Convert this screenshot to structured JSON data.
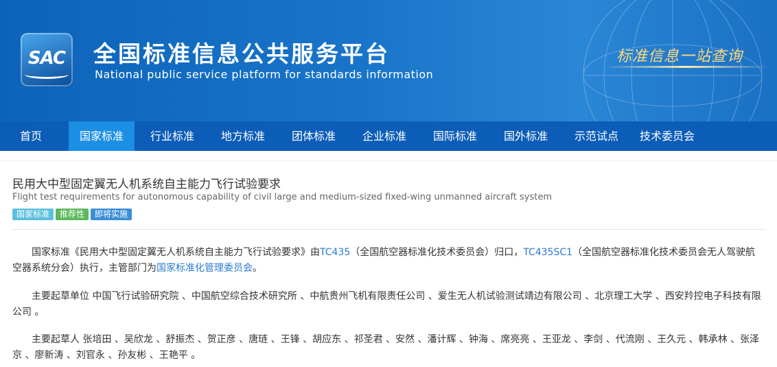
{
  "header": {
    "logo_text": "SAC",
    "title_cn": "全国标准信息公共服务平台",
    "title_en": "National public service platform  for standards information",
    "slogan": "标准信息一站查询"
  },
  "nav": {
    "items": [
      "首页",
      "国家标准",
      "行业标准",
      "地方标准",
      "团体标准",
      "企业标准",
      "国际标准",
      "国外标准",
      "示范试点",
      "技术委员会"
    ],
    "active_index": 1
  },
  "standard": {
    "title_cn": "民用大中型固定翼无人机系统自主能力飞行试验要求",
    "title_en": "Flight test requirements for autonomous capability of civil large and medium-sized fixed-wing unmanned aircraft system",
    "badges": [
      "国家标准",
      "推荐性",
      "即将实施"
    ],
    "desc": {
      "part1": "国家标准《民用大中型固定翼无人机系统自主能力飞行试验要求》由",
      "tc_link": "TC435",
      "part2": "（全国航空器标准化技术委员会）归口，",
      "sc_link": "TC435SC1",
      "part3": "（全国航空器标准化技术委员会无人驾驶航空器系统分会）执行，主管部门为",
      "dept_link": "国家标准化管理委员会",
      "part4": "。"
    },
    "drafting_units": "主要起草单位 中国飞行试验研究院 、中国航空综合技术研究所 、中航贵州飞机有限责任公司 、爱生无人机试验测试靖边有限公司 、北京理工大学 、西安羚控电子科技有限公司 。",
    "drafters": "主要起草人 张培田 、吴欣龙 、舒振杰 、贺正彦 、唐琏 、王锋 、胡应东 、祁圣君 、安然 、潘计辉 、钟海 、席亮亮 、王亚龙 、李剑 、代流刚 、王久元 、韩承林 、张泽京 、廖新涛 、刘官永 、孙友彬 、王艳平 。"
  },
  "colors": {
    "banner": "#1874c9",
    "nav": "#0b5db7",
    "nav_active": "#1a8fe3",
    "link": "#2a7bd0"
  }
}
